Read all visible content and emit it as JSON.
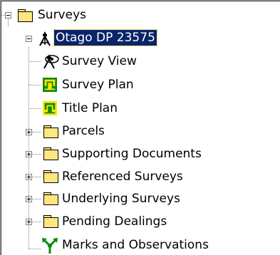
{
  "tree": {
    "root": {
      "label": "Surveys",
      "icon": "folder-icon",
      "state": "expanded"
    },
    "survey": {
      "label": "Otago DP 23575",
      "icon": "survey-tripod-icon",
      "state": "expanded",
      "selected": true
    },
    "children": [
      {
        "label": "Survey View",
        "icon": "survey-view-icon"
      },
      {
        "label": "Survey Plan",
        "icon": "survey-plan-icon"
      },
      {
        "label": "Title Plan",
        "icon": "title-plan-icon"
      },
      {
        "label": "Parcels",
        "icon": "folder-icon",
        "state": "collapsed"
      },
      {
        "label": "Supporting Documents",
        "icon": "folder-icon",
        "state": "collapsed"
      },
      {
        "label": "Referenced Surveys",
        "icon": "folder-icon",
        "state": "collapsed"
      },
      {
        "label": "Underlying Surveys",
        "icon": "folder-icon",
        "state": "collapsed"
      },
      {
        "label": "Pending Dealings",
        "icon": "folder-icon",
        "state": "collapsed"
      },
      {
        "label": "Marks and Observations",
        "icon": "marks-observations-icon"
      }
    ]
  },
  "colors": {
    "selection_bg": "#0a246a",
    "selection_text": "#ffffff",
    "folder_yellow": "#ffe680",
    "plan_green": "#0a8a10",
    "title_yellow": "#ffe600",
    "connector_gray": "#808080"
  }
}
